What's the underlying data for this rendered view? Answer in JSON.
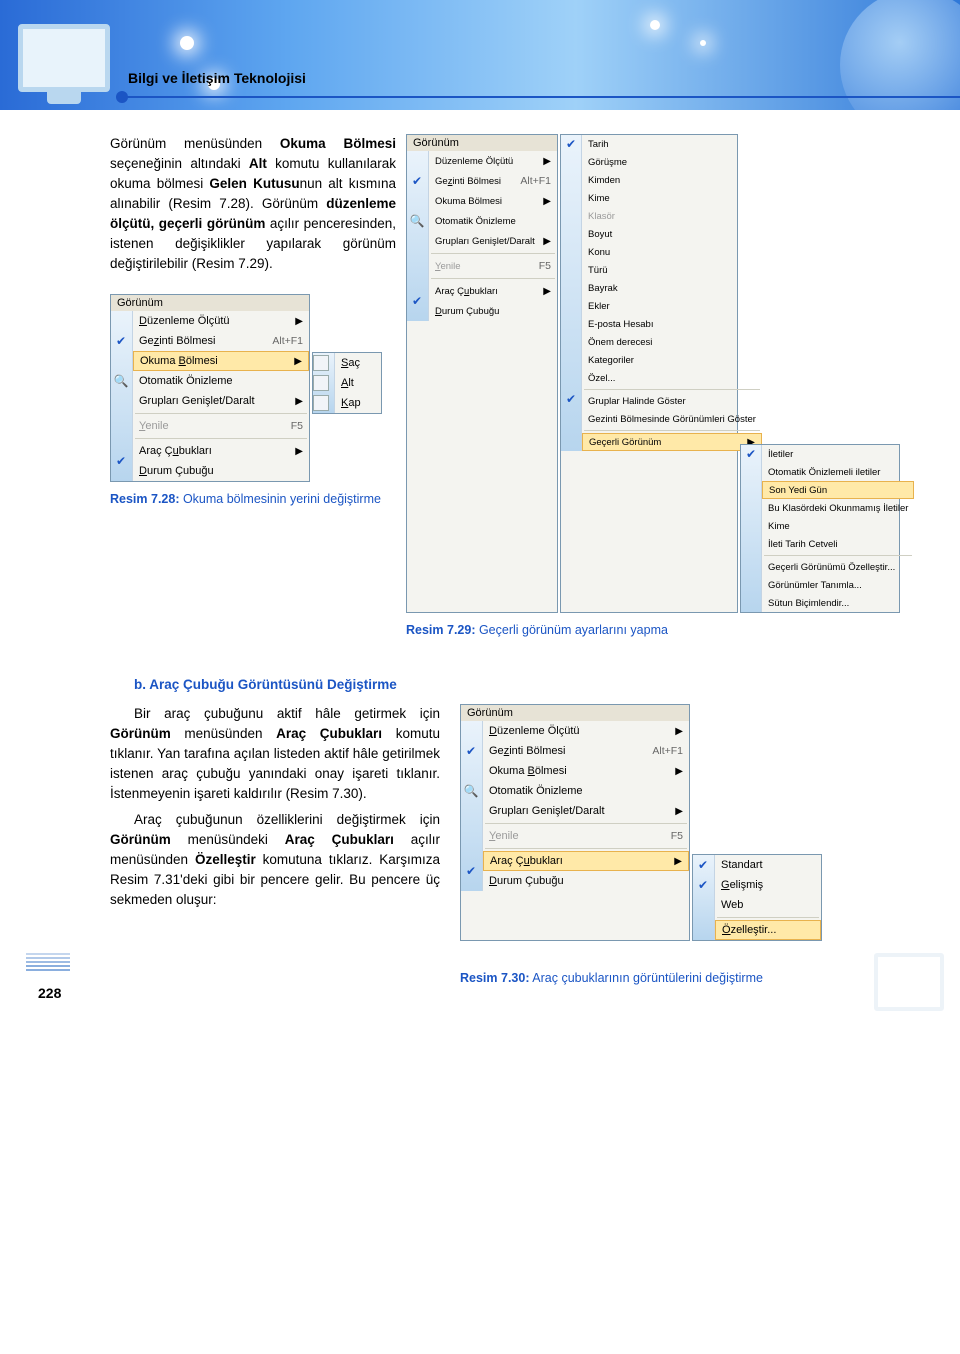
{
  "header": {
    "page_title": "Bilgi ve İletişim Teknolojisi"
  },
  "para1_parts": {
    "a": "Görünüm menüsünden ",
    "b": "Okuma Bölmesi",
    "c": " seçeneğinin altındaki ",
    "d": "Alt",
    "e": " komutu kullanılarak okuma bölmesi ",
    "f": "Gelen Kutusu",
    "g": "nun alt kısmına alınabilir (Resim 7.28). Görünüm ",
    "h": "düzenleme ölçütü, geçerli görünüm",
    "i": " açılır penceresinden, istenen değişiklikler yapılarak görünüm değiştirilebilir (Resim 7.29)."
  },
  "menu728": {
    "title": "Görünüm",
    "items": [
      {
        "label": "Düzenleme Ölçütü",
        "arrow": true
      },
      {
        "label": "Gezinti Bölmesi",
        "shortcut": "Alt+F1",
        "check": true,
        "accel": "z"
      },
      {
        "label": "Okuma Bölmesi",
        "arrow": true,
        "hi": true,
        "accel": "B"
      },
      {
        "label": "Otomatik Önizleme",
        "icon": true
      },
      {
        "label": "Grupları Genişlet/Daralt",
        "arrow": true
      },
      {
        "label": "Yenile",
        "shortcut": "F5",
        "dis": true,
        "accel": "Y"
      },
      {
        "label": "Araç Çubukları",
        "arrow": true,
        "accel": "u"
      },
      {
        "label": "Durum Çubuğu",
        "check": true,
        "accel": "D"
      }
    ],
    "sub": [
      {
        "label": "Saç",
        "icon": true,
        "accel": "S"
      },
      {
        "label": "Alt",
        "icon": true,
        "accel": "A"
      },
      {
        "label": "Kap",
        "icon": true,
        "accel": "K"
      }
    ]
  },
  "menu729": {
    "a": {
      "title": "Görünüm",
      "items": [
        {
          "label": "Düzenleme Ölçütü",
          "arrow": true
        },
        {
          "label": "Gezinti Bölmesi",
          "shortcut": "Alt+F1",
          "check": true,
          "accel": "z"
        },
        {
          "label": "Okuma Bölmesi",
          "arrow": true
        },
        {
          "label": "Otomatik Önizleme",
          "icon": true
        },
        {
          "label": "Grupları Genişlet/Daralt",
          "arrow": true
        },
        {
          "label": "Yenile",
          "shortcut": "F5",
          "dis": true,
          "accel": "Y"
        },
        {
          "label": "Araç Çubukları",
          "arrow": true,
          "accel": "u"
        },
        {
          "label": "Durum Çubuğu",
          "check": true,
          "accel": "D"
        }
      ]
    },
    "b": {
      "items": [
        {
          "label": "Tarih",
          "check": true
        },
        {
          "label": "Görüşme"
        },
        {
          "label": "Kimden",
          "accel": "n"
        },
        {
          "label": "Kime"
        },
        {
          "label": "Klasör",
          "dis": true
        },
        {
          "label": "Boyut",
          "accel": "B"
        },
        {
          "label": "Konu",
          "accel": "K"
        },
        {
          "label": "Türü"
        },
        {
          "label": "Bayrak",
          "accel": "B"
        },
        {
          "label": "Ekler",
          "accel": "E"
        },
        {
          "label": "E-posta Hesabı",
          "accel": "E"
        },
        {
          "label": "Önem derecesi"
        },
        {
          "label": "Kategoriler",
          "accel": "g"
        },
        {
          "label": "Özel...",
          "accel": "Ö"
        },
        {
          "label": "Gruplar Halinde Göster",
          "check": true,
          "sepBefore": true
        },
        {
          "label": "Gezinti Bölmesinde Görünümleri Göster",
          "accel": "G"
        },
        {
          "label": "Geçerli Görünüm",
          "arrow": true,
          "hi": true,
          "sepBefore": true,
          "accel": "G"
        }
      ]
    },
    "c": {
      "items": [
        {
          "label": "İletiler",
          "check": true
        },
        {
          "label": "Otomatik Önizlemeli iletiler"
        },
        {
          "label": "Son Yedi Gün",
          "hi": true
        },
        {
          "label": "Bu Klasördeki Okunmamış İletiler"
        },
        {
          "label": "Kime"
        },
        {
          "label": "İleti Tarih Cetveli"
        },
        {
          "label": "Geçerli Görünümü Özelleştir...",
          "sepBefore": true
        },
        {
          "label": "Görünümler Tanımla...",
          "accel": "T"
        },
        {
          "label": "Sütun Biçimlendir...",
          "accel": "B"
        }
      ]
    }
  },
  "caption728": "Resim 7.28: Okuma bölmesinin yerini değiştirme",
  "caption729": "Resim 7.29: Geçerli görünüm ayarlarını yapma",
  "section_b_head": "b. Araç Çubuğu Görüntüsünü Değiştirme",
  "para3_parts": {
    "a": "Bir araç çubuğunu aktif hâle getirmek için ",
    "b": "Görünüm",
    "c": " menüsünden ",
    "d": "Araç Çubukları",
    "e": " komutu tıklanır. Yan tarafına açılan listeden aktif hâle getirilmek istenen araç çubuğu yanındaki onay işareti tıklanır. İstenmeyenin işareti kaldırılır (Resim 7.30)."
  },
  "para4_parts": {
    "a": "Araç çubuğunun özelliklerini değiştirmek için ",
    "b": "Görünüm",
    "c": " menüsündeki ",
    "d": "Araç Çubukları",
    "e": " açılır menüsünden ",
    "f": "Özelleştir",
    "g": " komutuna tıklarız. Karşımıza Resim 7.31'deki gibi bir pencere gelir. Bu pencere üç sekmeden oluşur:"
  },
  "menu730": {
    "title": "Görünüm",
    "items": [
      {
        "label": "Düzenleme Ölçütü",
        "arrow": true,
        "accel": "D"
      },
      {
        "label": "Gezinti Bölmesi",
        "shortcut": "Alt+F1",
        "check": true,
        "accel": "z"
      },
      {
        "label": "Okuma Bölmesi",
        "arrow": true,
        "accel": "B"
      },
      {
        "label": "Otomatik Önizleme",
        "icon": true
      },
      {
        "label": "Grupları Genişlet/Daralt",
        "arrow": true
      },
      {
        "label": "Yenile",
        "shortcut": "F5",
        "dis": true,
        "accel": "Y"
      },
      {
        "label": "Araç Çubukları",
        "arrow": true,
        "hi": true,
        "accel": "u"
      },
      {
        "label": "Durum Çubuğu",
        "check": true,
        "accel": "D"
      }
    ],
    "sub": [
      {
        "label": "Standart",
        "check": true
      },
      {
        "label": "Gelişmiş",
        "check": true,
        "accel": "G"
      },
      {
        "label": "Web"
      },
      {
        "label": "Özelleştir...",
        "hi": true,
        "sepBefore": true,
        "accel": "Ö"
      }
    ]
  },
  "caption730": "Resim 7.30: Araç çubuklarının görüntülerini değiştirme",
  "page_number": "228"
}
